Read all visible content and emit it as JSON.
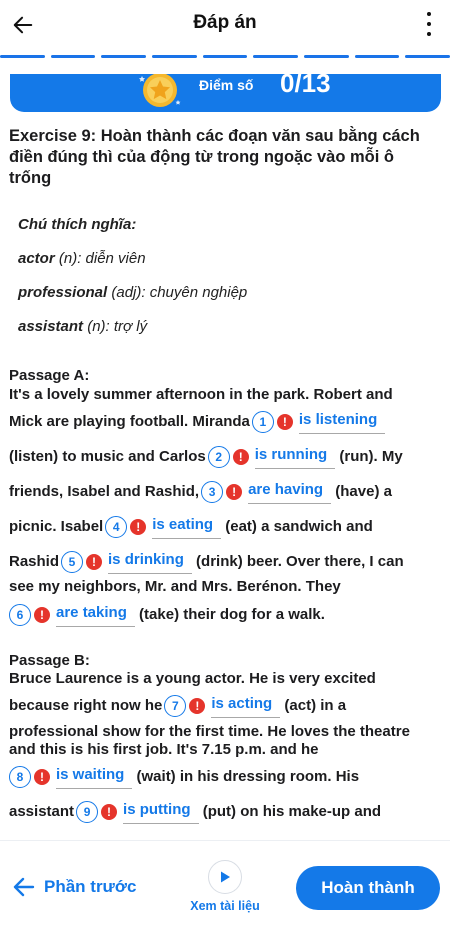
{
  "header": {
    "title": "Đáp án"
  },
  "progress": {
    "segments": 9
  },
  "score": {
    "label": "Điểm số",
    "value": "0/13"
  },
  "exercise": {
    "title": "Exercise 9: Hoàn thành các đoạn văn sau bằng cách điền đúng thì của động từ trong ngoặc vào mỗi ô trống"
  },
  "glossary": {
    "heading": "Chú thích nghĩa:",
    "items": [
      {
        "term": "actor",
        "meaning": " (n): diễn viên"
      },
      {
        "term": "professional",
        "meaning": " (adj): chuyên nghiệp"
      },
      {
        "term": "assistant",
        "meaning": " (n): trợ lý"
      }
    ]
  },
  "passageA": {
    "heading": "Passage A:",
    "l1": "It's a lovely summer afternoon in the park. Robert and",
    "l2a": "Mick are playing football. Miranda",
    "l3a": "(listen) to music and Carlos",
    "l3b": "(run). My",
    "l4a": "friends, Isabel and Rashid,",
    "l4b": "(have) a",
    "l5a": "picnic. Isabel",
    "l5b": "(eat) a sandwich and",
    "l6a": "Rashid",
    "l6b": "(drink) beer. Over there, I can",
    "l7": "see my neighbors, Mr. and Mrs. Berénon. They",
    "l8b": "(take) their dog for a walk."
  },
  "passageB": {
    "heading": "Passage B:",
    "l1": "Bruce Laurence is a young actor. He is very excited",
    "l2a": "because right now he",
    "l2b": "(act) in a",
    "l3": "professional show for the first time. He loves the theatre",
    "l4": "and this is his first job. It's 7.15 p.m. and he",
    "l5b": "(wait) in his dressing room. His",
    "l6a": "assistant",
    "l6b": "(put) on his make-up and"
  },
  "answers": [
    {
      "num": "1",
      "text": "is listening"
    },
    {
      "num": "2",
      "text": "is running"
    },
    {
      "num": "3",
      "text": "are having"
    },
    {
      "num": "4",
      "text": "is eating"
    },
    {
      "num": "5",
      "text": "is drinking"
    },
    {
      "num": "6",
      "text": "are taking"
    },
    {
      "num": "7",
      "text": "is acting"
    },
    {
      "num": "8",
      "text": "is waiting"
    },
    {
      "num": "9",
      "text": "is putting"
    }
  ],
  "footer": {
    "prev_label": "Phần trước",
    "docs_label": "Xem tài liệu",
    "finish_label": "Hoàn thành"
  },
  "colors": {
    "primary": "#1479e8",
    "error": "#e5342b"
  },
  "icons": {
    "back": "arrow-left-icon",
    "more": "more-vertical-icon",
    "medal": "star-medal-icon",
    "warning": "warning-icon",
    "play": "play-icon"
  }
}
